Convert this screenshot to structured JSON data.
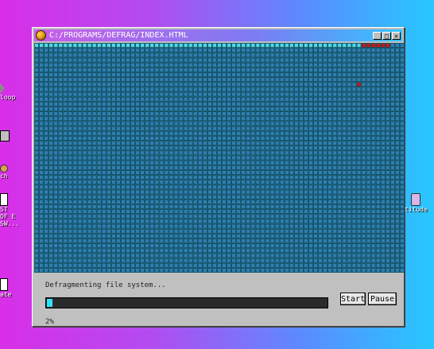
{
  "desktop": {
    "icons": [
      {
        "label": "loop",
        "icon": "loop-icon"
      },
      {
        "label": "",
        "icon": "computer-icon"
      },
      {
        "label": "ch",
        "icon": "paint-icon"
      },
      {
        "label": "ST OF E SW...",
        "icon": "document-icon"
      },
      {
        "label": "ate",
        "icon": "notepad-icon"
      }
    ],
    "right_icon": {
      "label": "titude",
      "icon": "jar-icon"
    }
  },
  "window": {
    "title": "C:/PROGRAMS/DEFRAG/INDEX.HTML",
    "icon": "defrag-app-icon",
    "controls": {
      "minimize": "_",
      "maximize": "□",
      "close": "×"
    }
  },
  "defrag": {
    "columns": 77,
    "rows": 47,
    "colors": {
      "done": "#4fd8e6",
      "pending": "#2f7fb0",
      "fragment": "#c41a1a"
    },
    "done_blocks": 68,
    "fragment_blocks_row0": [
      68,
      69,
      70,
      71,
      72,
      73
    ],
    "fragment_blocks_other": [
      {
        "row": 8,
        "col": 67
      }
    ]
  },
  "status": {
    "text": "Defragmenting file system...",
    "progress": 0.02,
    "percent_label": "2%"
  },
  "buttons": {
    "start": "Start",
    "pause": "Pause"
  }
}
